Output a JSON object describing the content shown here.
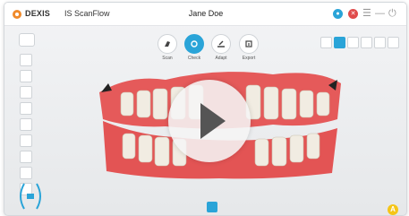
{
  "app": {
    "brand": "DEXIS",
    "name": "IS ScanFlow",
    "patient": "Jane Doe"
  },
  "titlebar": {
    "user_initial": "●",
    "close_symbol": "✕",
    "menu_symbol": "☰",
    "minimize_symbol": "—",
    "power_symbol": "⏻"
  },
  "tools": [
    {
      "label": "Scan",
      "icon": "scanner-icon"
    },
    {
      "label": "Check",
      "icon": "check-icon"
    },
    {
      "label": "Adapt",
      "icon": "adapt-icon"
    },
    {
      "label": "Export",
      "icon": "export-icon"
    }
  ],
  "colors": {
    "accent": "#2aa4d8",
    "brand": "#f08a2b",
    "badge": "#f5c518"
  },
  "badge_letter": "A",
  "video": {
    "state": "paused",
    "icon": "play-icon"
  }
}
